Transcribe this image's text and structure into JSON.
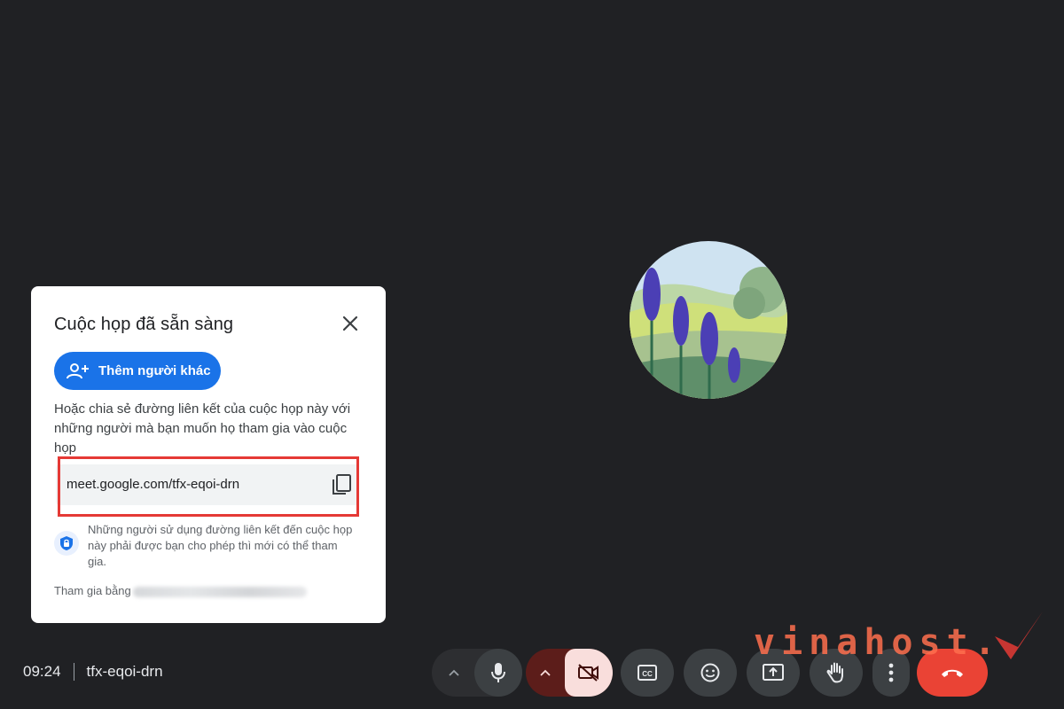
{
  "dialog": {
    "title": "Cuộc họp đã sẵn sàng",
    "add_people_label": "Thêm người khác",
    "description": "Hoặc chia sẻ đường liên kết của cuộc họp này với những người mà bạn muốn họ tham gia vào cuộc họp",
    "meeting_link": "meet.google.com/tfx-eqoi-drn",
    "security_note": "Những người sử dụng đường liên kết đến cuộc họp này phải được bạn cho phép thì mới có thể tham gia.",
    "joined_as_label": "Tham gia bằng"
  },
  "bottom_bar": {
    "time": "09:24",
    "meeting_code": "tfx-eqoi-drn"
  },
  "watermark": {
    "text": "vinahost."
  },
  "colors": {
    "background": "#202124",
    "primary_button": "#1a73e8",
    "end_call": "#ea4335",
    "camera_off": "#f9dedc",
    "highlight": "#e53935"
  },
  "icons": {
    "close": "close-icon",
    "add_person": "person-add-icon",
    "copy": "copy-icon",
    "shield": "shield-lock-icon",
    "mic": "mic-icon",
    "camera_off": "videocam-off-icon",
    "captions": "closed-caption-icon",
    "emoji": "emoji-icon",
    "present": "present-screen-icon",
    "raise_hand": "raise-hand-icon",
    "more": "more-vert-icon",
    "end_call": "call-end-icon"
  }
}
